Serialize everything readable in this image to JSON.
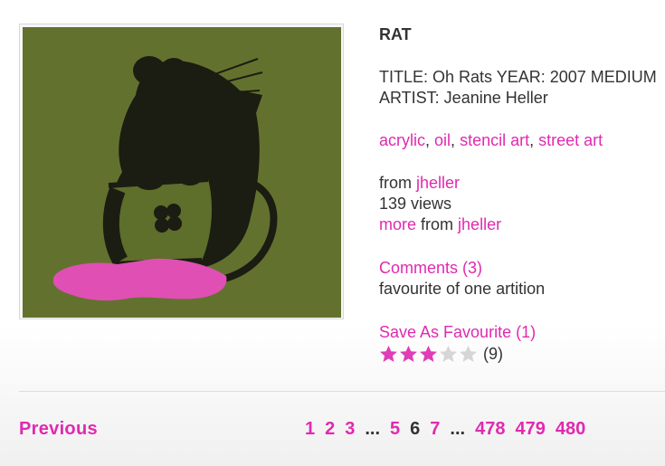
{
  "artwork": {
    "icon": "rat-stencil-artwork"
  },
  "info": {
    "title": "RAT",
    "desc_line1": "TITLE: Oh Rats YEAR: 2007 MEDIUM",
    "desc_line2": "ARTIST: Jeanine Heller",
    "tags": [
      "acrylic",
      "oil",
      "stencil art",
      "street art"
    ],
    "from_prefix": "from",
    "author": "jheller",
    "views": "139 views",
    "more_link": "more",
    "more_from": "from",
    "more_author": "jheller",
    "comments_link": "Comments (3)",
    "favourite_text": "favourite of one artition",
    "save_link": "Save As Favourite (1)",
    "rating": 3,
    "rating_max": 5,
    "rating_count": "(9)"
  },
  "pager": {
    "previous": "Previous",
    "pages": [
      "1",
      "2",
      "3",
      "...",
      "5",
      "6",
      "7",
      "...",
      "478",
      "479",
      "480"
    ],
    "current": "6"
  },
  "colors": {
    "accent": "#e02ab0",
    "star_on": "#e03db7",
    "star_off": "#d6d6d6"
  }
}
